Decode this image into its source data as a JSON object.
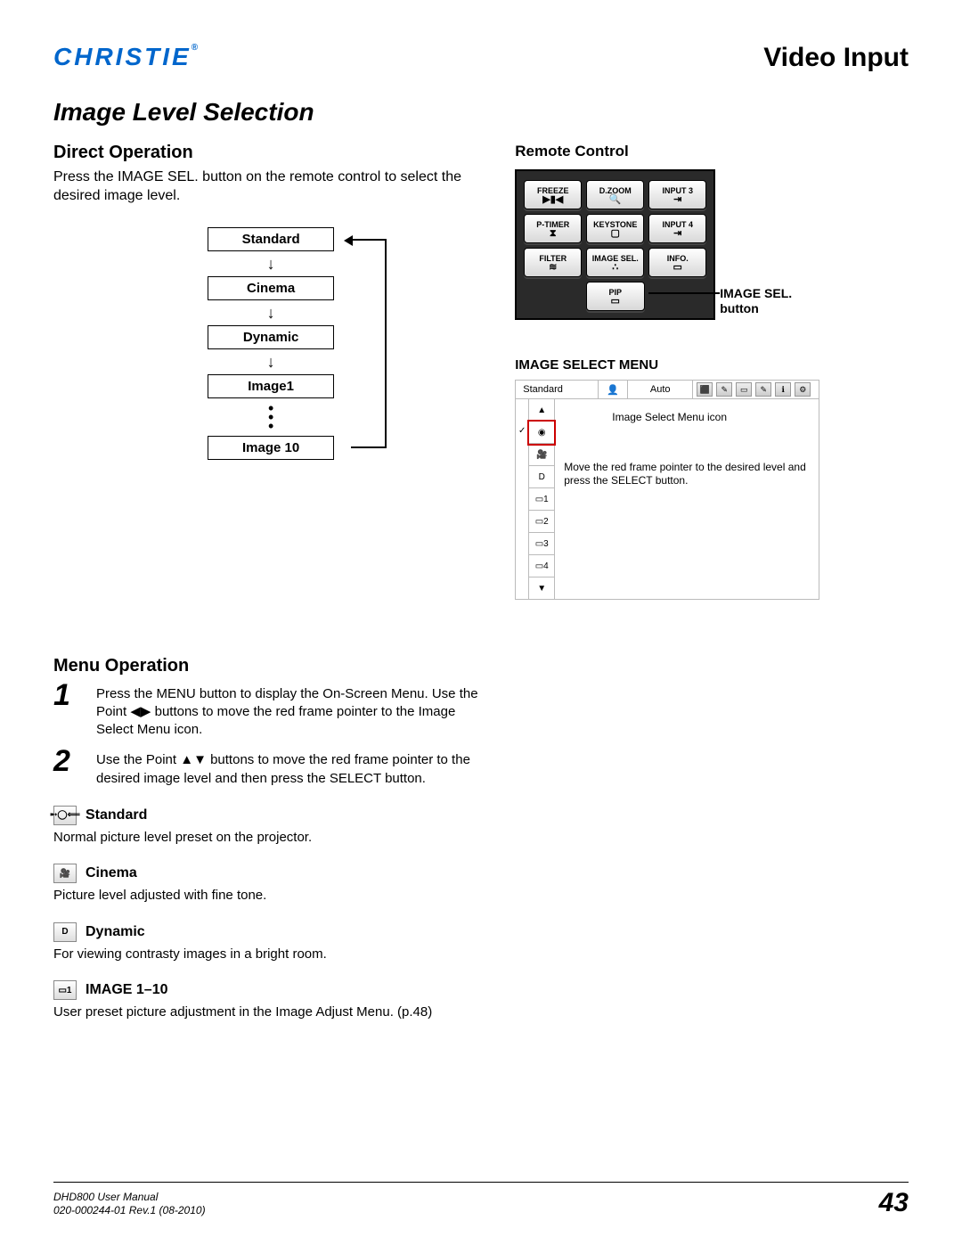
{
  "brand": "CHRISTIE",
  "chapter": "Video Input",
  "section_title": "Image Level Selection",
  "direct_op": {
    "heading": "Direct Operation",
    "text": "Press the IMAGE SEL. button on the remote control to select the desired image level."
  },
  "cycle": {
    "items": [
      "Standard",
      "Cinema",
      "Dynamic",
      "Image1",
      "Image 10"
    ]
  },
  "remote": {
    "heading": "Remote Control",
    "rows": [
      [
        "FREEZE",
        "D.ZOOM",
        "INPUT 3"
      ],
      [
        "P-TIMER",
        "KEYSTONE",
        "INPUT 4"
      ],
      [
        "FILTER",
        "IMAGE SEL.",
        "INFO."
      ]
    ],
    "glyphs": [
      [
        "▶▮◀",
        "🔍",
        "⇥"
      ],
      [
        "⧗",
        "▢",
        "⇥"
      ],
      [
        "≋",
        "∴",
        "▭"
      ]
    ],
    "pip": "PIP",
    "callout": "IMAGE SEL. button"
  },
  "menu_op": {
    "heading": "Menu Operation",
    "steps": [
      "Press the MENU button to display the On-Screen Menu. Use the Point ◀▶ buttons to move the red frame pointer to the Image Select Menu icon.",
      "Use the Point ▲▼ buttons to move the red frame pointer to the desired image level and then press the SELECT button."
    ],
    "items": [
      {
        "icon": "➸◯⟸",
        "title": "Standard",
        "desc": "Normal picture level preset on the projector."
      },
      {
        "icon": "🎥",
        "title": "Cinema",
        "desc": "Picture level adjusted with fine tone."
      },
      {
        "icon": "D",
        "title": "Dynamic",
        "desc": "For viewing contrasty images in a bright room."
      },
      {
        "icon": "▭1",
        "title": "IMAGE 1–10",
        "desc": "User preset picture adjustment in the Image Adjust Menu. (p.48)"
      }
    ]
  },
  "ism": {
    "title": "IMAGE SELECT MENU",
    "top_label": "Standard",
    "top_auto": "Auto",
    "side": [
      "▲",
      "◉",
      "🎥",
      "D",
      "▭1",
      "▭2",
      "▭3",
      "▭4",
      "▼"
    ],
    "check": "✓",
    "callout1": "Image Select Menu icon",
    "callout2": "Move the red frame pointer to the desired level and press the SELECT button."
  },
  "footer": {
    "line1": "DHD800 User Manual",
    "line2": "020-000244-01 Rev.1 (08-2010)",
    "page": "43"
  }
}
